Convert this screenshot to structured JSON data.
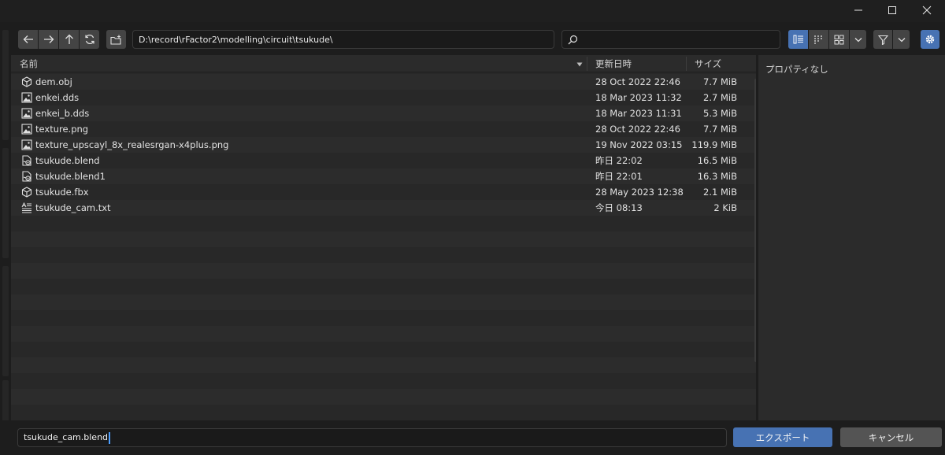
{
  "toolbar": {
    "icons": [
      "back-arrow-icon",
      "forward-arrow-icon",
      "parent-directory-icon",
      "refresh-icon",
      "new-folder-icon",
      "search-icon",
      "vertical-list-icon",
      "horizontal-list-icon",
      "thumbnails-icon",
      "chevron-down-icon",
      "filter-icon",
      "gear-icon"
    ],
    "path": "D:\\record\\rFactor2\\modelling\\circuit\\tsukude\\",
    "search_value": "",
    "display_mode": "vertical-list"
  },
  "columns": {
    "name": "名前",
    "date": "更新日時",
    "size": "サイズ"
  },
  "files": [
    {
      "name": "dem.obj",
      "date": "28 Oct 2022 22:46",
      "size": "7.7 MiB",
      "icon": "mesh-icon"
    },
    {
      "name": "enkei.dds",
      "date": "18 Mar 2023 11:32",
      "size": "2.7 MiB",
      "icon": "image-icon"
    },
    {
      "name": "enkei_b.dds",
      "date": "18 Mar 2023 11:31",
      "size": "5.3 MiB",
      "icon": "image-icon"
    },
    {
      "name": "texture.png",
      "date": "28 Oct 2022 22:46",
      "size": "7.7 MiB",
      "icon": "image-icon"
    },
    {
      "name": "texture_upscayl_8x_realesrgan-x4plus.png",
      "date": "19 Nov 2022 03:15",
      "size": "119.9 MiB",
      "icon": "image-icon"
    },
    {
      "name": "tsukude.blend",
      "date": "昨日 22:02",
      "size": "16.5 MiB",
      "icon": "blend-file-icon"
    },
    {
      "name": "tsukude.blend1",
      "date": "昨日 22:01",
      "size": "16.3 MiB",
      "icon": "blend-file-icon"
    },
    {
      "name": "tsukude.fbx",
      "date": "28 May 2023 12:38",
      "size": "2.1 MiB",
      "icon": "mesh-icon"
    },
    {
      "name": "tsukude_cam.txt",
      "date": "今日 08:13",
      "size": "2 KiB",
      "icon": "text-file-icon"
    }
  ],
  "side_panel": {
    "no_properties": "プロパティなし"
  },
  "bottom": {
    "filename": "tsukude_cam.blend",
    "export_label": "エクスポート",
    "cancel_label": "キャンセル"
  },
  "colors": {
    "accent": "#4772b3",
    "background": "#282828",
    "row_alt": "#2c2c2c"
  }
}
